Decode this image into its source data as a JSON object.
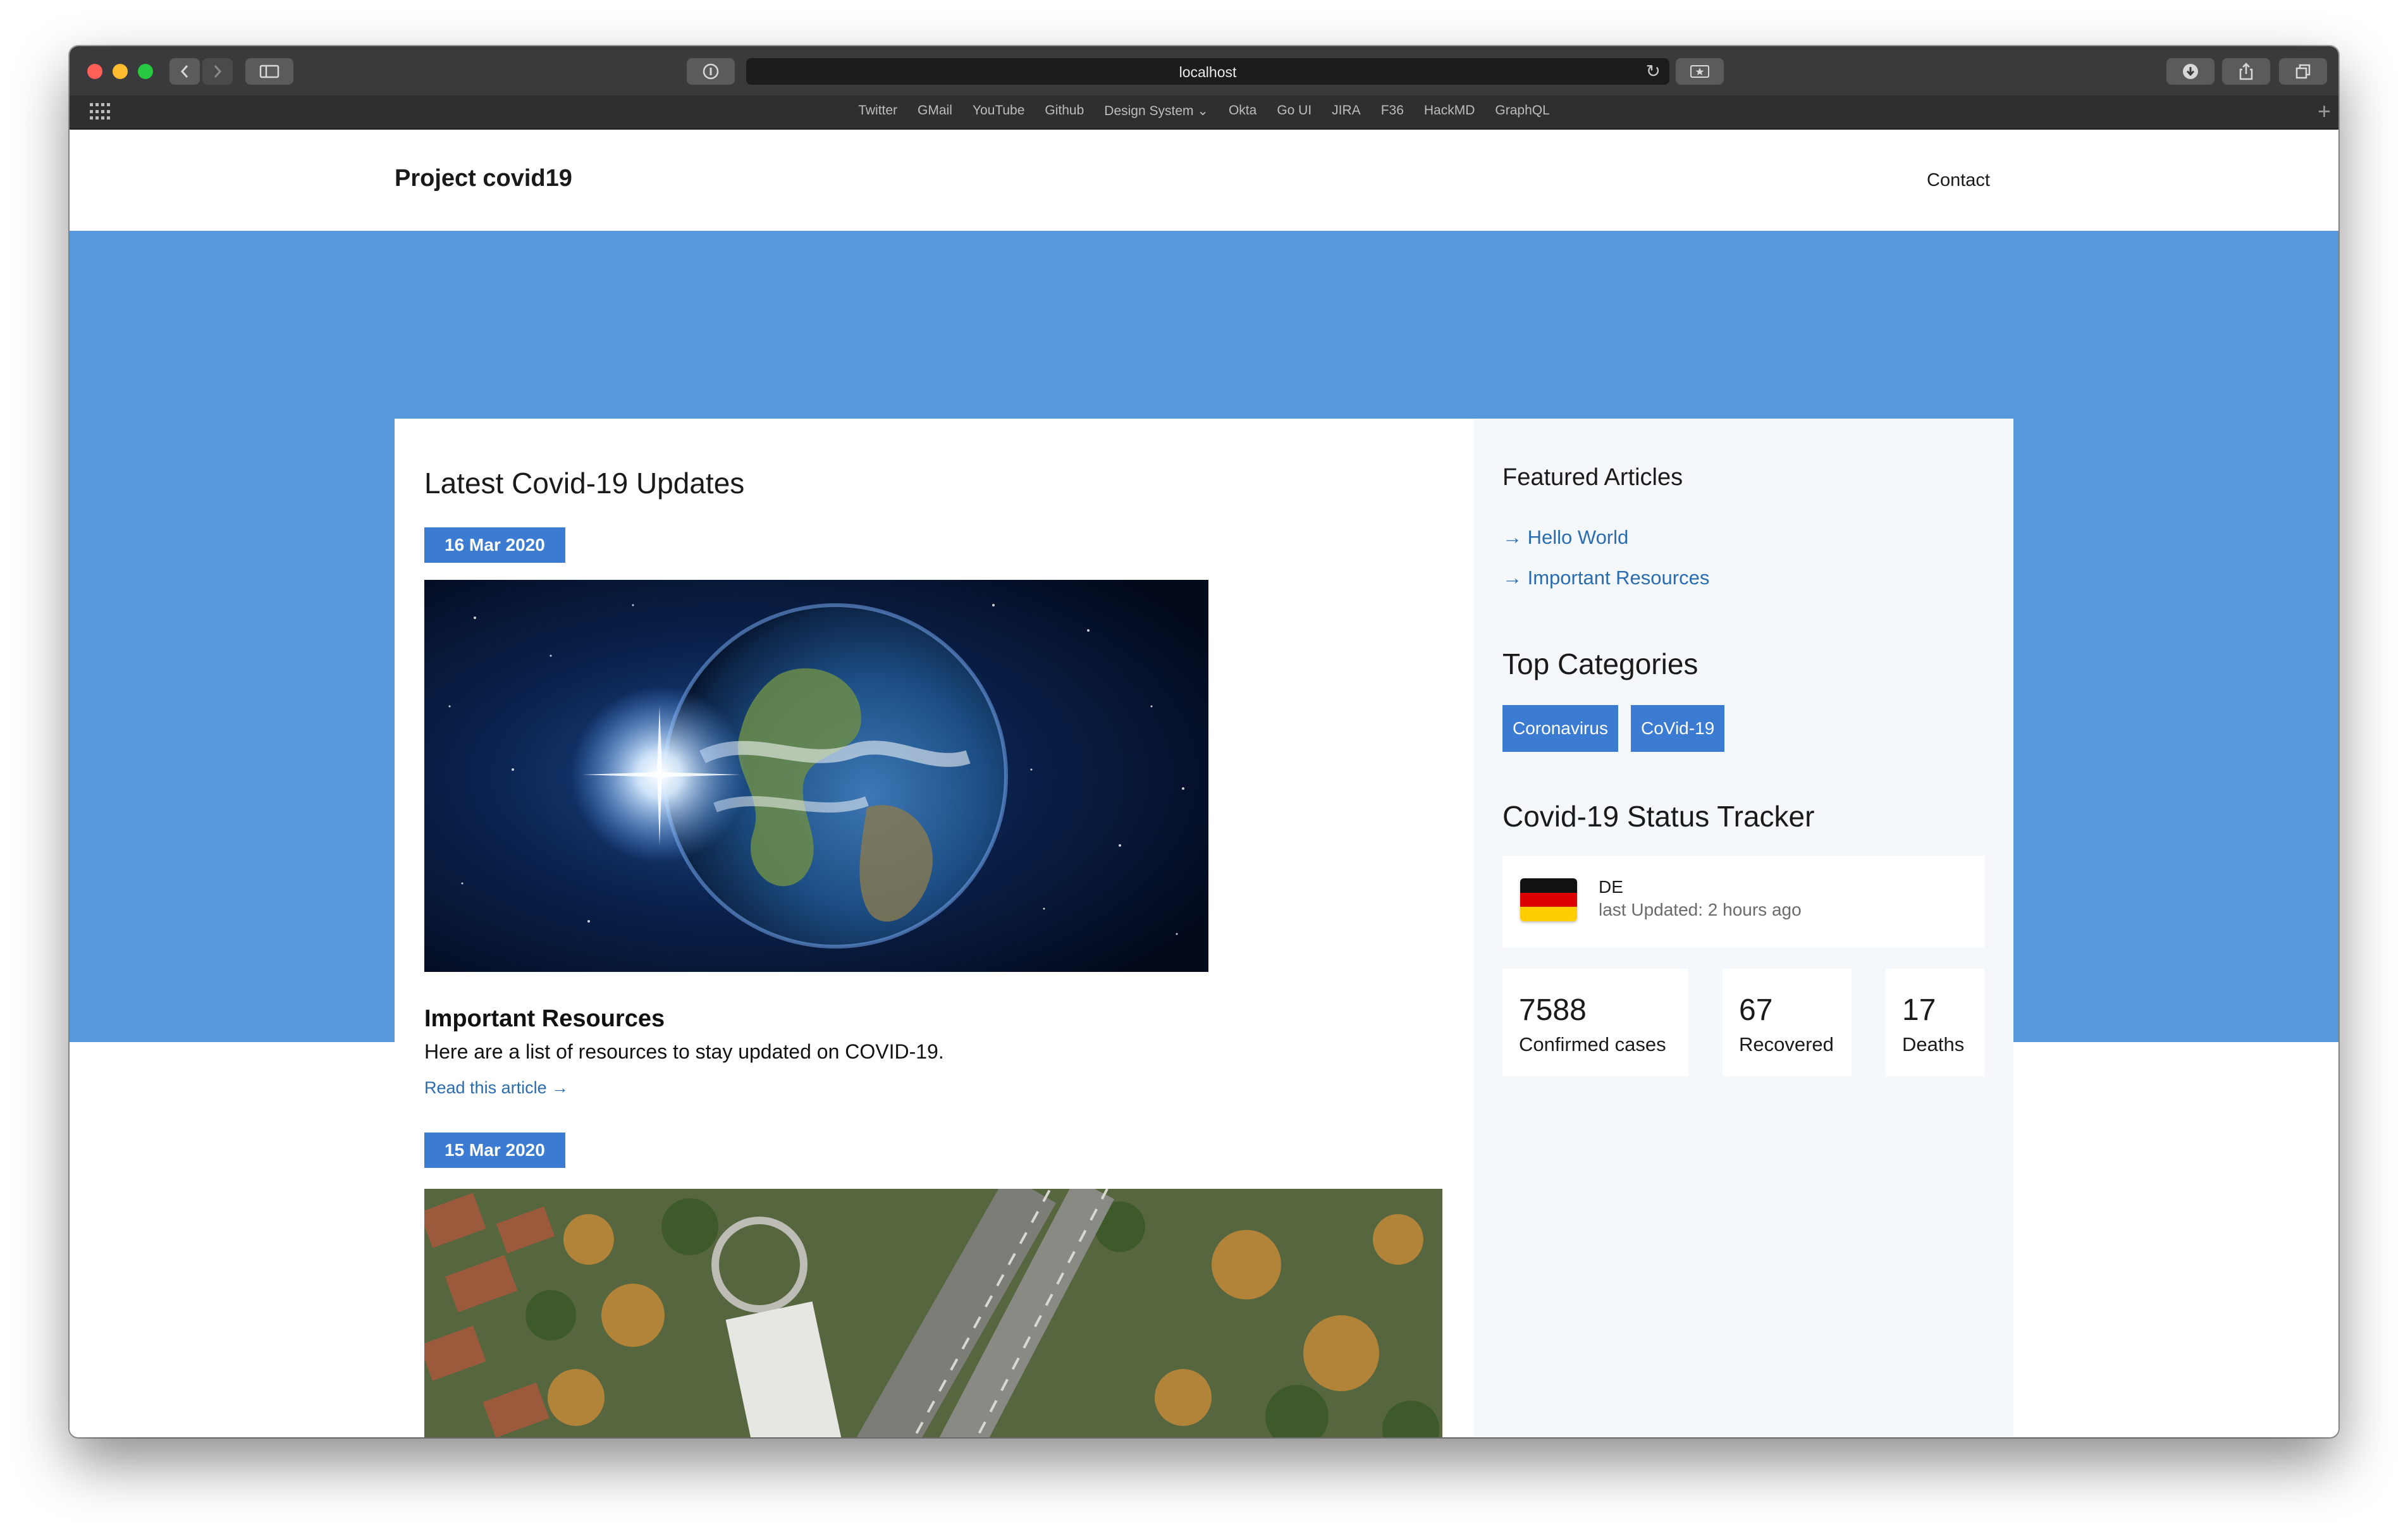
{
  "browser": {
    "url": "localhost",
    "favorites": [
      "Twitter",
      "GMail",
      "YouTube",
      "Github",
      "Design System ⌄",
      "Okta",
      "Go UI",
      "JIRA",
      "F36",
      "HackMD",
      "GraphQL"
    ]
  },
  "site": {
    "brand": "Project covid19",
    "nav_contact": "Contact"
  },
  "main": {
    "heading": "Latest Covid-19 Updates",
    "articles": [
      {
        "date": "16 Mar 2020",
        "title": "Important Resources",
        "description": "Here are a list of resources to stay updated on COVID-19.",
        "link": "Read this article →"
      },
      {
        "date": "15 Mar 2020"
      }
    ]
  },
  "sidebar": {
    "featured_heading": "Featured Articles",
    "featured_links": [
      "→ Hello World",
      "→ Important Resources"
    ],
    "categories_heading": "Top Categories",
    "categories": [
      "Coronavirus",
      "CoVid-19"
    ],
    "tracker_heading": "Covid-19 Status Tracker",
    "tracker": {
      "country": "DE",
      "last_updated": "last Updated: 2 hours ago",
      "stats": [
        {
          "value": "7588",
          "label": "Confirmed cases"
        },
        {
          "value": "67",
          "label": "Recovered"
        },
        {
          "value": "17",
          "label": "Deaths"
        }
      ]
    }
  },
  "colors": {
    "hero": "#5797dc",
    "accent": "#3b7bd1",
    "link": "#2b6cb0"
  }
}
